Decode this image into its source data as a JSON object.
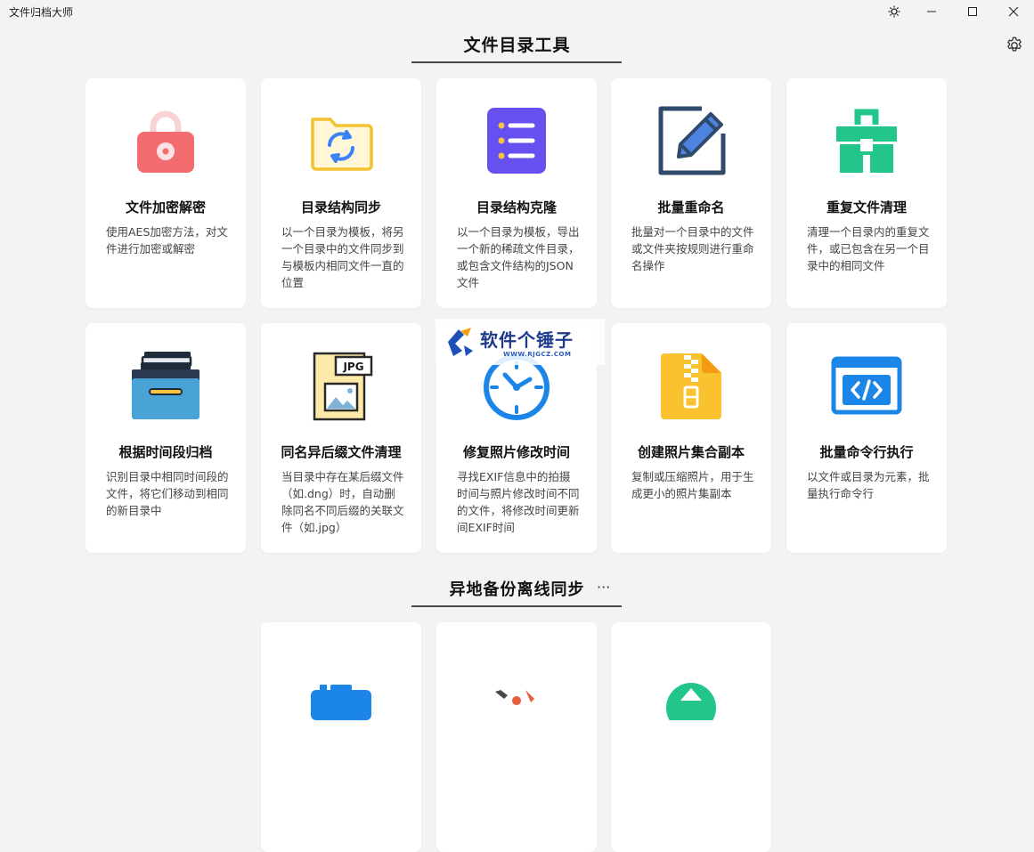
{
  "app": {
    "title": "文件归档大师",
    "section1_title": "文件目录工具",
    "section2_title": "异地备份离线同步",
    "more_label": "···"
  },
  "cards": [
    {
      "title": "文件加密解密",
      "desc": "使用AES加密方法，对文件进行加密或解密"
    },
    {
      "title": "目录结构同步",
      "desc": "以一个目录为模板，将另一个目录中的文件同步到与模板内相同文件一直的位置"
    },
    {
      "title": "目录结构克隆",
      "desc": "以一个目录为模板，导出一个新的稀疏文件目录，或包含文件结构的JSON文件"
    },
    {
      "title": "批量重命名",
      "desc": "批量对一个目录中的文件或文件夹按规则进行重命名操作"
    },
    {
      "title": "重复文件清理",
      "desc": "清理一个目录内的重复文件，或已包含在另一个目录中的相同文件"
    },
    {
      "title": "根据时间段归档",
      "desc": "识别目录中相同时间段的文件，将它们移动到相同的新目录中"
    },
    {
      "title": "同名异后缀文件清理",
      "desc": "当目录中存在某后缀文件（如.dng）时，自动删除同名不同后缀的关联文件（如.jpg）"
    },
    {
      "title": "修复照片修改时间",
      "desc": "寻找EXIF信息中的拍摄时间与照片修改时间不同的文件，将修改时间更新间EXIF时间"
    },
    {
      "title": "创建照片集合副本",
      "desc": "复制或压缩照片，用于生成更小的照片集副本"
    },
    {
      "title": "批量命令行执行",
      "desc": "以文件或目录为元素，批量执行命令行"
    }
  ],
  "watermark": {
    "text": "软件个锤子",
    "sub": "WWW.RJGCZ.COM"
  },
  "icons": {
    "encrypt": "lock-icon",
    "sync": "folder-sync-icon",
    "clone": "list-icon",
    "rename": "edit-icon",
    "dedupe": "toolbox-icon",
    "archive": "archive-box-icon",
    "cleanup": "jpg-file-icon",
    "time": "clock-icon",
    "photo": "zip-file-icon",
    "cmd": "code-window-icon"
  }
}
